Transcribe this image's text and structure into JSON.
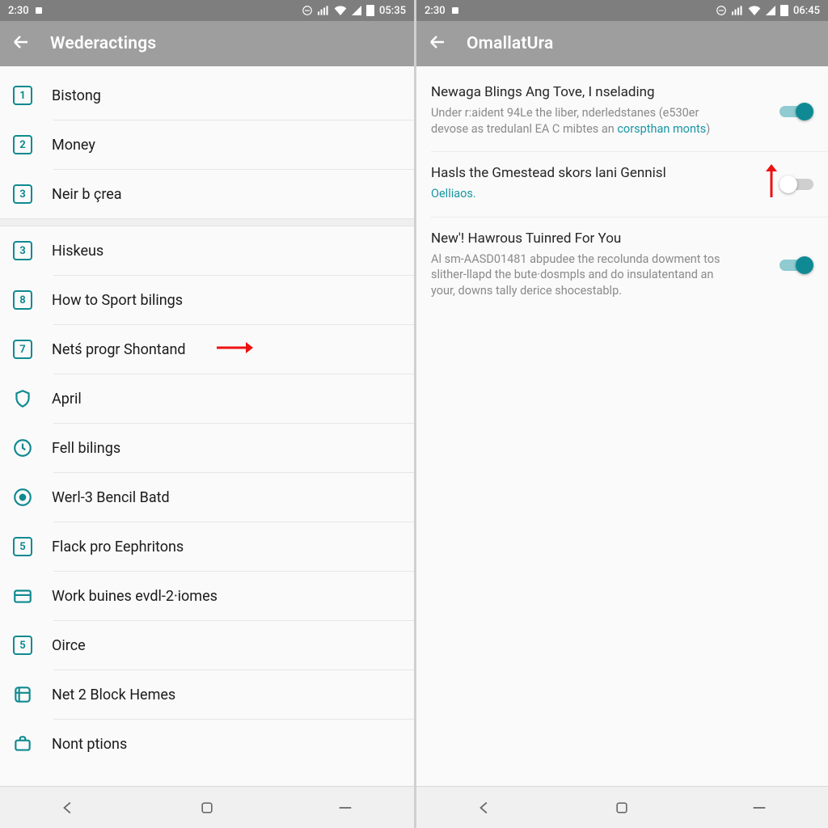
{
  "left": {
    "status_time": "2:30",
    "status_clock": "05:35",
    "appbar_title": "Wederactings",
    "items": [
      {
        "icon_type": "num",
        "icon_val": "1",
        "label": "Bistong"
      },
      {
        "icon_type": "num",
        "icon_val": "2",
        "label": "Money"
      },
      {
        "icon_type": "num",
        "icon_val": "3",
        "label": "Neir b çrea"
      }
    ],
    "items2": [
      {
        "icon_type": "num",
        "icon_val": "3",
        "label": "Hiskeus"
      },
      {
        "icon_type": "num",
        "icon_val": "8",
        "label": "How to Sport bilings"
      },
      {
        "icon_type": "num",
        "icon_val": "7",
        "label": "Netś progr Shontand",
        "arrow": true
      },
      {
        "icon_type": "svg",
        "icon_val": "shield",
        "label": "April"
      },
      {
        "icon_type": "svg",
        "icon_val": "clock",
        "label": "Fell bilings"
      },
      {
        "icon_type": "svg",
        "icon_val": "target",
        "label": "Werl-3 Bencil Batd"
      },
      {
        "icon_type": "num",
        "icon_val": "5",
        "label": "Flack pro Eephritons"
      },
      {
        "icon_type": "svg",
        "icon_val": "card",
        "label": "Work buines evdl-2·iomes"
      },
      {
        "icon_type": "num",
        "icon_val": "5",
        "label": "Oirce"
      },
      {
        "icon_type": "svg",
        "icon_val": "tag",
        "label": "Net 2 Block Hemes"
      },
      {
        "icon_type": "svg",
        "icon_val": "briefcase",
        "label": "Nont ptions"
      }
    ]
  },
  "right": {
    "status_time": "2:30",
    "status_clock": "06:45",
    "appbar_title": "OmallatUra",
    "settings": [
      {
        "title": "Newaga Blings Ang Tove, I nselading",
        "desc_a": "Under r:aident 94Le the liber, nderledstanes (e530er devose as tredulanl EA C mibtes an ",
        "desc_link": "corspthan monts",
        "desc_b": ")",
        "toggle": "on",
        "arrow_up": true
      },
      {
        "title": "Hasls the Gmestead skors lani Gennisl",
        "desc_link": "Oelliaos.",
        "desc_a": "",
        "desc_b": "",
        "toggle": "off"
      },
      {
        "title": "New'! Hawrous Tuinred For You",
        "desc_a": "Al sm-AASD01481 abpudee the recolunda dowment tos slither-llapd the bute·dosmpls and do insulatentand an your, downs tally derice shocestablp.",
        "desc_link": "",
        "desc_b": "",
        "toggle": "on"
      }
    ]
  },
  "icons": {
    "back": "back-arrow-icon"
  }
}
